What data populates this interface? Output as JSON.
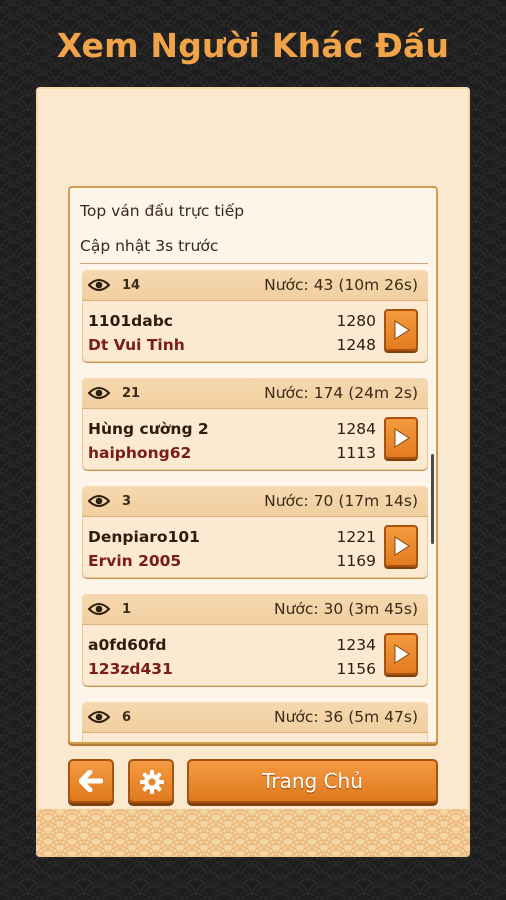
{
  "title": "Xem Người Khác Đấu",
  "panel": {
    "heading": "Top ván đấu trực tiếp",
    "updated": "Cập nhật 3s trước"
  },
  "games": [
    {
      "views": "14",
      "moves": "Nước: 43 (10m 26s)",
      "player1": "1101dabc",
      "score1": "1280",
      "player2": "Dt Vui Tinh",
      "score2": "1248"
    },
    {
      "views": "21",
      "moves": "Nước: 174 (24m 2s)",
      "player1": "Hùng cường 2",
      "score1": "1284",
      "player2": "haiphong62",
      "score2": "1113"
    },
    {
      "views": "3",
      "moves": "Nước: 70 (17m 14s)",
      "player1": "Denpiaro101",
      "score1": "1221",
      "player2": "Ervin 2005",
      "score2": "1169"
    },
    {
      "views": "1",
      "moves": "Nước: 30 (3m 45s)",
      "player1": "a0fd60fd",
      "score1": "1234",
      "player2": "123zd431",
      "score2": "1156"
    },
    {
      "views": "6",
      "moves": "Nước: 36 (5m 47s)",
      "player1": "",
      "score1": "",
      "player2": "",
      "score2": ""
    }
  ],
  "footer": {
    "back_icon": "arrow-left-icon",
    "settings_icon": "gear-icon",
    "home_label": "Trang Chủ"
  },
  "colors": {
    "accent": "#e8862a",
    "title": "#f0a348",
    "player2_text": "#7a1d16"
  }
}
